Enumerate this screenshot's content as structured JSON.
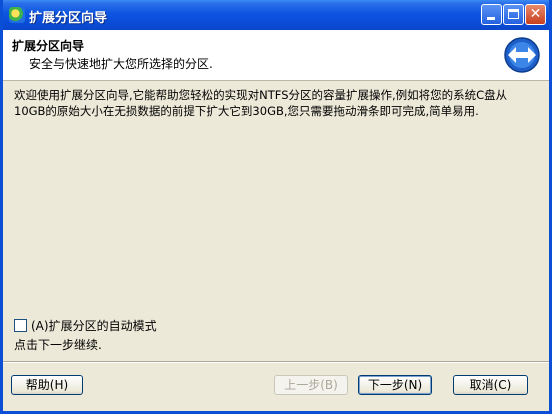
{
  "window": {
    "title": "扩展分区向导"
  },
  "header": {
    "title": "扩展分区向导",
    "subtitle": "安全与快速地扩大您所选择的分区."
  },
  "content": {
    "intro": "欢迎使用扩展分区向导,它能帮助您轻松的实现对NTFS分区的容量扩展操作,例如将您的系统C盘从10GB的原始大小在无损数据的前提下扩大它到30GB,您只需要拖动滑条即可完成,简单易用.",
    "auto_mode_label": "(A)扩展分区的自动模式",
    "auto_mode_checked": false,
    "hint": "点击下一步继续."
  },
  "buttons": {
    "help": "帮助(H)",
    "back": "上一步(B)",
    "next": "下一步(N)",
    "cancel": "取消(C)"
  },
  "icons": {
    "app": "wizard-app-icon",
    "header": "resize-arrows-icon",
    "minimize": "minimize-icon",
    "maximize": "maximize-icon",
    "close": "close-icon"
  },
  "colors": {
    "titlebar": "#0a4bd6",
    "client": "#ece9d8",
    "close_button": "#c8401e"
  }
}
